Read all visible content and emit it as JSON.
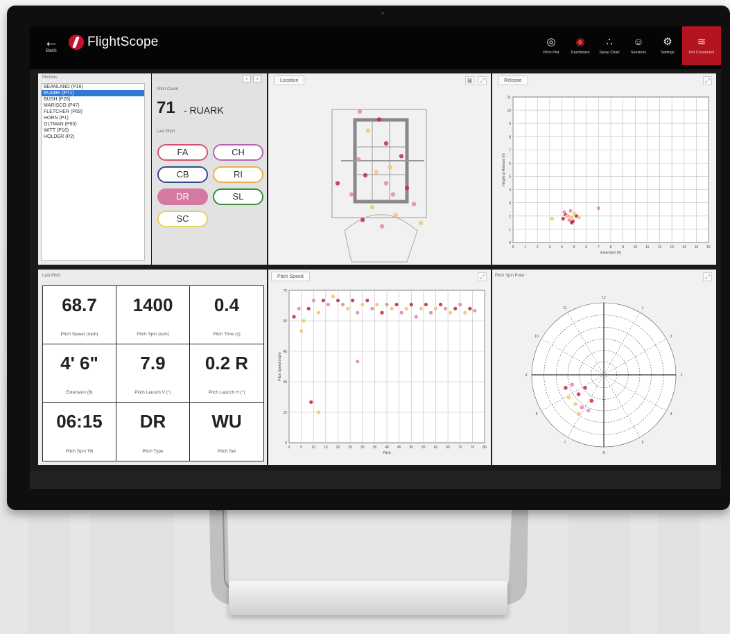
{
  "header": {
    "back_label": "Back",
    "brand": "FlightScope",
    "nav": [
      {
        "label": "Pitch Plot",
        "icon": "target-icon",
        "active": false
      },
      {
        "label": "Dashboard",
        "icon": "gauge-icon",
        "active": true
      },
      {
        "label": "Spray Chart",
        "icon": "spray-icon",
        "active": false
      },
      {
        "label": "Sessions",
        "icon": "person-icon",
        "active": false
      },
      {
        "label": "Settings",
        "icon": "gear-icon",
        "active": false
      },
      {
        "label": "Not Connected",
        "icon": "wifi-icon",
        "active": false
      }
    ]
  },
  "pitchers": {
    "title": "Pitchers",
    "items": [
      "BEANLAND (P16)",
      "RUARK (P71)",
      "BUSH (P26)",
      "MARISCO (P47)",
      "FLETCHER (P69)",
      "HORN (P1)",
      "OLTMAN (P65)",
      "WITT (P16)",
      "HOLDER (P2)"
    ],
    "selected_index": 1
  },
  "selected": {
    "label": "Pitch Count",
    "number": "71",
    "name": "- RUARK",
    "last_pitch_label": "Last Pitch",
    "pitch_types": [
      {
        "code": "FA",
        "color": "#d9506e",
        "filled": false
      },
      {
        "code": "CH",
        "color": "#b763b3",
        "filled": false
      },
      {
        "code": "CB",
        "color": "#2f4c8c",
        "filled": false
      },
      {
        "code": "RI",
        "color": "#e6b34a",
        "filled": false
      },
      {
        "code": "DR",
        "color": "#d47aa2",
        "filled": true
      },
      {
        "code": "SL",
        "color": "#3c8c3c",
        "filled": false
      },
      {
        "code": "SC",
        "color": "#e8d060",
        "filled": false
      }
    ]
  },
  "stats": {
    "title": "Last Pitch",
    "cells": [
      {
        "value": "68.7",
        "label": "Pitch Speed (mph)"
      },
      {
        "value": "1400",
        "label": "Pitch Spin (rpm)"
      },
      {
        "value": "0.4",
        "label": "Pitch Time (s)"
      },
      {
        "value": "4' 6\"",
        "label": "Extension (ft)"
      },
      {
        "value": "7.9",
        "label": "Pitch Launch V (°)"
      },
      {
        "value": "0.2 R",
        "label": "Pitch Launch H (°)"
      },
      {
        "value": "06:15",
        "label": "Pitch Spin Tilt"
      },
      {
        "value": "DR",
        "label": "Pitch Type"
      },
      {
        "value": "WU",
        "label": "Pitch Set"
      }
    ]
  },
  "panels": {
    "location": "Location",
    "release": "Release",
    "speed": "Pitch Speed",
    "polar": "Pitch Spin Polar"
  },
  "chart_data": [
    {
      "type": "scatter",
      "title": "Location",
      "points": [
        [
          0.2,
          0.55
        ],
        [
          0.35,
          0.4
        ],
        [
          0.48,
          0.48
        ],
        [
          0.55,
          0.3
        ],
        [
          0.6,
          0.62
        ],
        [
          0.45,
          0.7
        ],
        [
          0.38,
          0.78
        ],
        [
          0.52,
          0.82
        ],
        [
          0.62,
          0.75
        ],
        [
          0.7,
          0.58
        ],
        [
          0.3,
          0.62
        ],
        [
          0.42,
          0.22
        ],
        [
          0.5,
          0.15
        ],
        [
          0.36,
          0.1
        ],
        [
          0.58,
          0.45
        ],
        [
          0.66,
          0.38
        ],
        [
          0.75,
          0.68
        ],
        [
          0.8,
          0.8
        ],
        [
          0.4,
          0.5
        ],
        [
          0.55,
          0.55
        ]
      ]
    },
    {
      "type": "scatter",
      "title": "Release",
      "xlabel": "Extension (ft)",
      "ylabel": "Height at Release (ft)",
      "xlim": [
        0,
        16
      ],
      "ylim": [
        0,
        11
      ],
      "points": [
        [
          4.1,
          1.8
        ],
        [
          4.5,
          2.0
        ],
        [
          4.8,
          1.9
        ],
        [
          4.3,
          2.1
        ],
        [
          4.6,
          1.7
        ],
        [
          5.0,
          2.2
        ],
        [
          4.9,
          1.6
        ],
        [
          4.2,
          2.3
        ],
        [
          4.4,
          2.0
        ],
        [
          5.2,
          2.0
        ],
        [
          4.7,
          2.4
        ],
        [
          3.2,
          1.8
        ],
        [
          4.8,
          1.5
        ],
        [
          7.0,
          2.6
        ],
        [
          5.4,
          1.9
        ]
      ]
    },
    {
      "type": "scatter",
      "title": "Pitch Speed",
      "xlabel": "Pitch",
      "ylabel": "Pitch Speed (mph)",
      "xlim": [
        0,
        80
      ],
      "ylim": [
        0,
        75
      ],
      "points": [
        [
          2,
          62
        ],
        [
          4,
          66
        ],
        [
          6,
          60
        ],
        [
          8,
          66
        ],
        [
          10,
          70
        ],
        [
          12,
          64
        ],
        [
          14,
          70
        ],
        [
          16,
          68
        ],
        [
          18,
          72
        ],
        [
          20,
          70
        ],
        [
          22,
          68
        ],
        [
          24,
          66
        ],
        [
          26,
          70
        ],
        [
          28,
          64
        ],
        [
          30,
          68
        ],
        [
          32,
          70
        ],
        [
          34,
          66
        ],
        [
          36,
          68
        ],
        [
          38,
          64
        ],
        [
          40,
          68
        ],
        [
          42,
          66
        ],
        [
          44,
          68
        ],
        [
          46,
          64
        ],
        [
          48,
          66
        ],
        [
          50,
          68
        ],
        [
          52,
          62
        ],
        [
          54,
          66
        ],
        [
          56,
          68
        ],
        [
          58,
          64
        ],
        [
          60,
          66
        ],
        [
          62,
          68
        ],
        [
          64,
          66
        ],
        [
          66,
          64
        ],
        [
          68,
          66
        ],
        [
          70,
          68
        ],
        [
          72,
          64
        ],
        [
          74,
          66
        ],
        [
          76,
          65
        ],
        [
          5,
          55
        ],
        [
          9,
          20
        ],
        [
          28,
          40
        ],
        [
          12,
          15
        ]
      ]
    },
    {
      "type": "scatter",
      "title": "Pitch Spin Polar",
      "points": [
        [
          0.3,
          0.2
        ],
        [
          0.4,
          0.15
        ],
        [
          0.35,
          0.35
        ],
        [
          0.5,
          0.3
        ],
        [
          0.55,
          0.5
        ],
        [
          0.45,
          0.45
        ],
        [
          0.6,
          0.2
        ],
        [
          0.65,
          0.55
        ],
        [
          0.5,
          0.6
        ],
        [
          0.7,
          0.4
        ]
      ]
    }
  ],
  "colors": {
    "accent": "#c8102e",
    "selection": "#2f78d6",
    "dot_red": "#c22b4a",
    "dot_pink": "#e58aa8",
    "dot_yellow": "#efc86b"
  }
}
